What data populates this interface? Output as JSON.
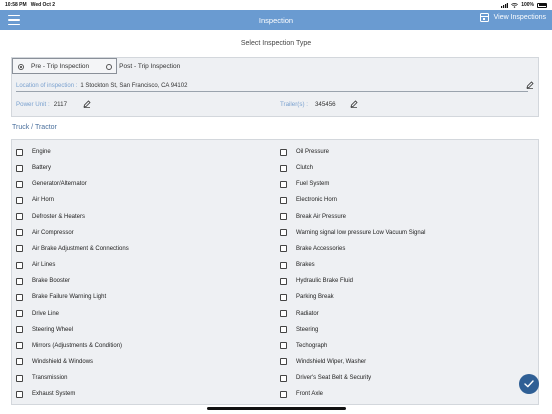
{
  "status_bar": {
    "time": "10:58 PM",
    "date": "Wed Oct 2",
    "battery": "100%"
  },
  "navbar": {
    "title": "Inspection",
    "view_button": "View Inspections",
    "menu_icon": "menu-icon",
    "view_icon": "calendar-icon"
  },
  "inspection_type": {
    "title": "Select Inspection Type",
    "options": [
      {
        "label": "Pre - Trip Inspection",
        "selected": true
      },
      {
        "label": "Post - Trip Inspection",
        "selected": false
      }
    ],
    "location_label": "Location of inspection :",
    "location_value": "1 Stockton St, San Francisco, CA 94102",
    "power_unit_label": "Power Unit :",
    "power_unit_value": "2117",
    "trailer_label": "Trailer(s) :",
    "trailer_value": "345456"
  },
  "checklist": {
    "title": "Truck / Tractor",
    "left": [
      "Engine",
      "Battery",
      "Generator/Alternator",
      "Air Horn",
      "Defroster & Heaters",
      "Air Compressor",
      "Air Brake Adjustment & Connections",
      "Air Lines",
      "Brake Booster",
      "Brake Failure Warning Light",
      "Drive Line",
      "Steering Wheel",
      "Mirrors (Adjustments & Condition)",
      "Windshield & Windows",
      "Transmission",
      "Exhaust System"
    ],
    "right": [
      "Oil Pressure",
      "Clutch",
      "Fuel System",
      "Electronic Horn",
      "Break Air Pressure",
      "Warning signal low pressure Low Vacuum Signal",
      "Brake Accessories",
      "Brakes",
      "Hydraulic Brake Fluid",
      "Parking Break",
      "Radiator",
      "Steering",
      "Techograph",
      "Windshield Wiper, Washer",
      "Driver's Seat Belt & Security",
      "Front Axle"
    ]
  },
  "colors": {
    "navbar": "#6a9bd1",
    "accent": "#2f5f95",
    "label": "#7aa1cf"
  }
}
